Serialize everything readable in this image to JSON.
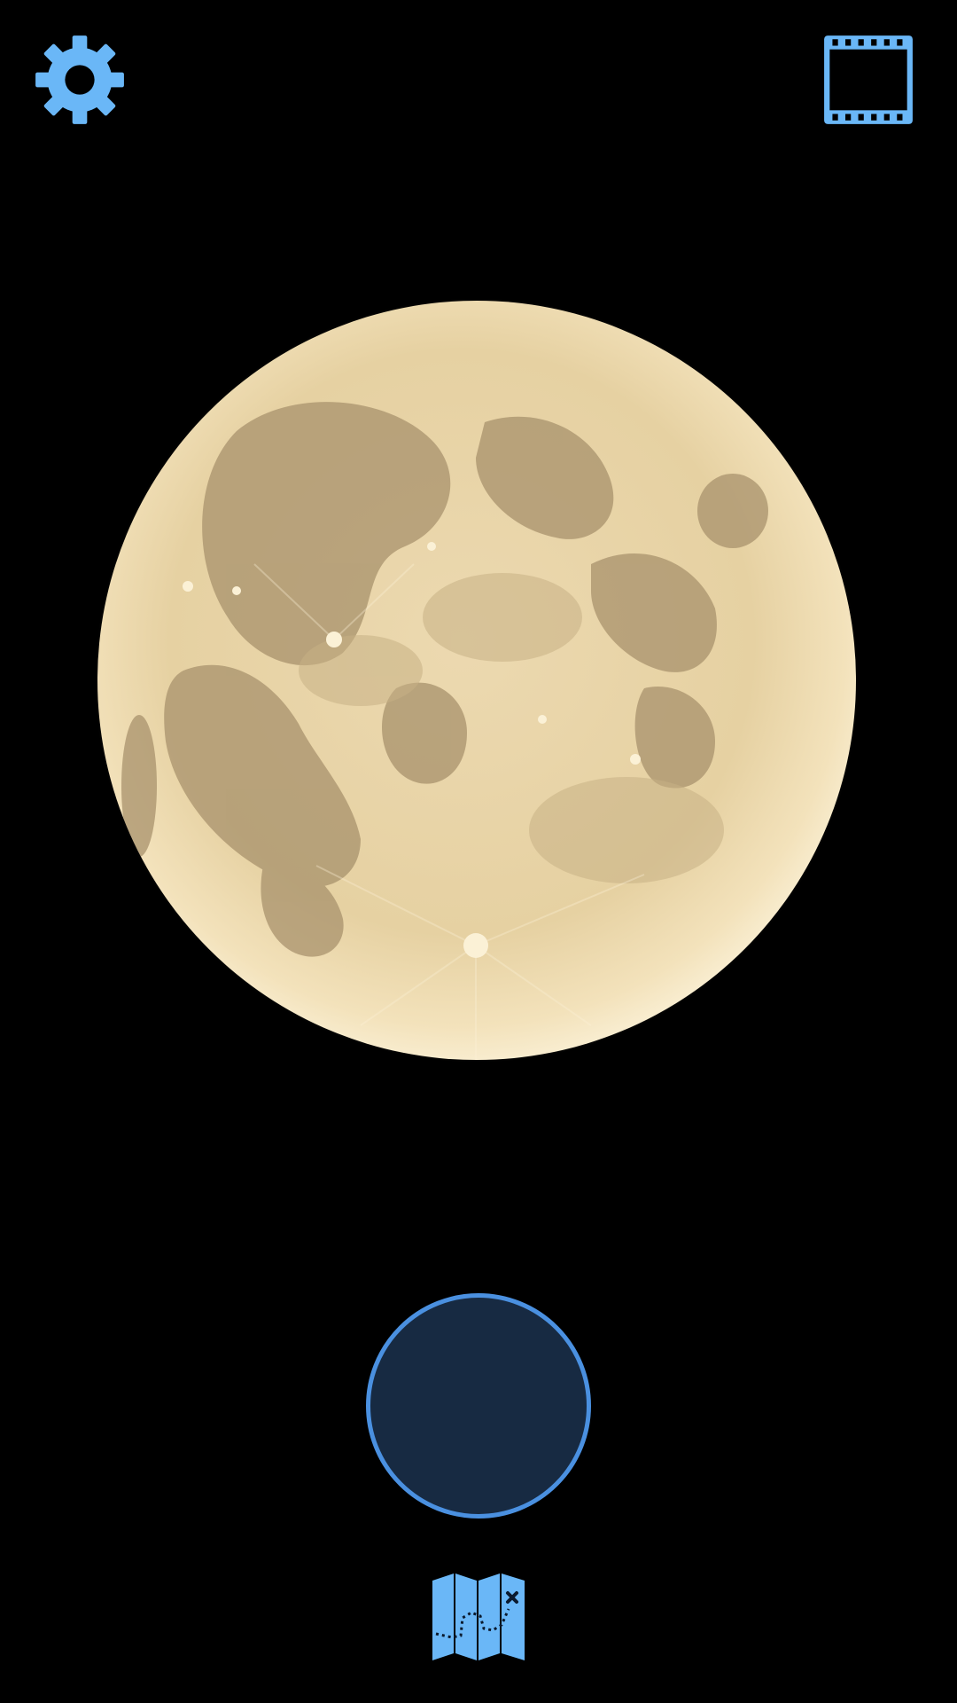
{
  "app": {
    "screen": "camera-viewfinder"
  },
  "colors": {
    "background": "#000000",
    "accent": "#6ab7f7",
    "shutter_ring": "#4a90e0",
    "shutter_fill": "#172a42",
    "moon_light": "#f3e2bb",
    "moon_mid": "#d9c293",
    "moon_mare": "#a8926c"
  },
  "toolbar": {
    "settings_icon": "gear-icon",
    "gallery_icon": "film-strip-icon"
  },
  "viewfinder": {
    "subject": "full-moon"
  },
  "controls": {
    "shutter_icon": "shutter-button",
    "map_icon": "folded-map-icon"
  }
}
